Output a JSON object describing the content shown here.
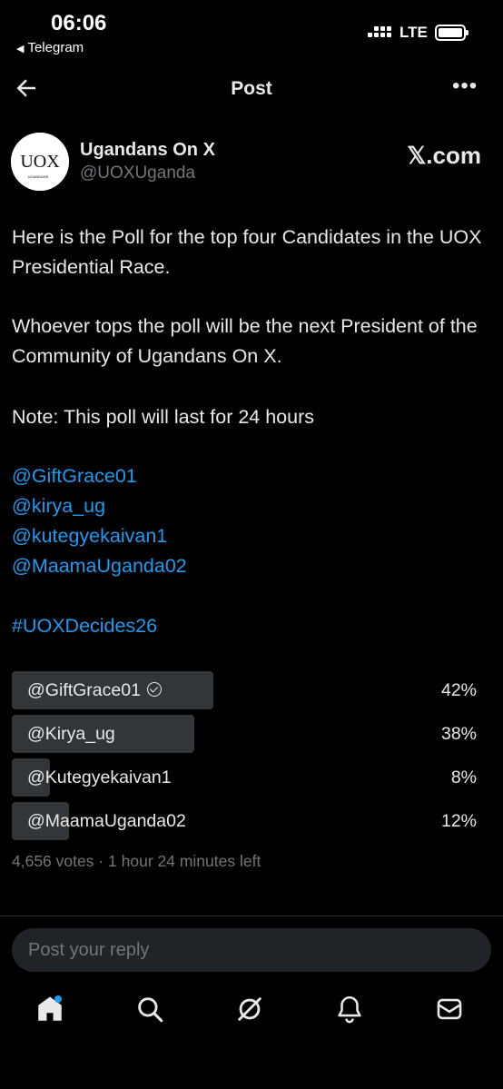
{
  "status_bar": {
    "time": "06:06",
    "back_app": "Telegram",
    "network": "LTE"
  },
  "header": {
    "title": "Post",
    "more_label": "•••"
  },
  "author": {
    "name": "Ugandans On X",
    "handle": "@UOXUganda",
    "source_label": "𝕏.com",
    "avatar_text": "UOX",
    "avatar_sub": "UGANDANS"
  },
  "post": {
    "paragraph_1": "Here is the Poll for the top four Candidates in the UOX Presidential Race.",
    "paragraph_2": "Whoever tops the poll will be the next President of the Community of Ugandans On X.",
    "paragraph_3": "Note: This poll will last for 24 hours",
    "mentions": [
      "@GiftGrace01",
      "@kirya_ug",
      "@kutegyekaivan1",
      "@MaamaUganda02"
    ],
    "hashtag": "#UOXDecides26"
  },
  "poll": {
    "options": [
      {
        "label": "@GiftGrace01",
        "percent_label": "42%",
        "percent": 42,
        "winner": true
      },
      {
        "label": "@Kirya_ug",
        "percent_label": "38%",
        "percent": 38,
        "winner": false
      },
      {
        "label": "@Kutegyekaivan1",
        "percent_label": "8%",
        "percent": 8,
        "winner": false
      },
      {
        "label": "@MaamaUganda02",
        "percent_label": "12%",
        "percent": 12,
        "winner": false
      }
    ],
    "meta": "4,656 votes · 1 hour 24 minutes left"
  },
  "reply": {
    "placeholder": "Post your reply"
  },
  "tabbar": {
    "items": [
      "home-icon",
      "search-icon",
      "grok-icon",
      "notifications-icon",
      "messages-icon"
    ],
    "accent": "#1d9bf0"
  },
  "colors": {
    "link": "#1d9bf0",
    "muted": "#71767b",
    "background": "#000000"
  }
}
